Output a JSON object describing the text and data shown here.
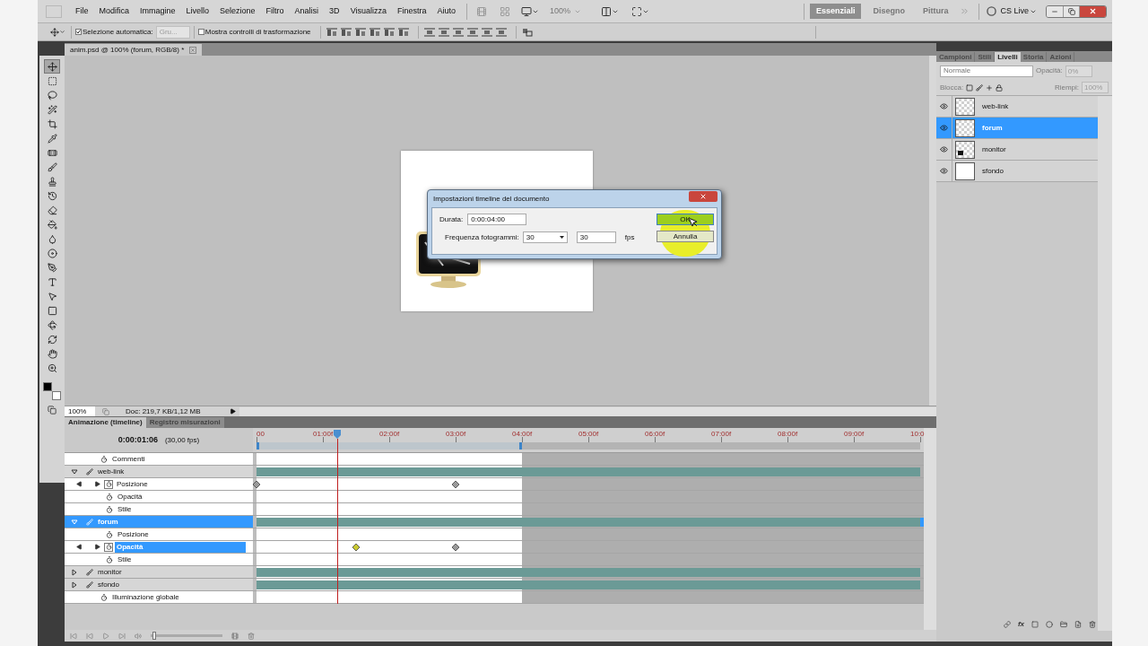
{
  "menu": [
    "File",
    "Modifica",
    "Immagine",
    "Livello",
    "Selezione",
    "Filtro",
    "Analisi",
    "3D",
    "Visualizza",
    "Finestra",
    "Aiuto"
  ],
  "zoom_menu": {
    "value": "100%",
    "disabled": true
  },
  "workspaces": [
    {
      "label": "Essenziali",
      "selected": true
    },
    {
      "label": "Disegno",
      "selected": false
    },
    {
      "label": "Pittura",
      "selected": false
    }
  ],
  "cs_live": "CS Live",
  "options": {
    "auto_select": {
      "label": "Selezione automatica:",
      "checked": true
    },
    "target": {
      "value": "Gru...",
      "disabled": true
    },
    "transform_controls": {
      "label": "Mostra controlli di trasformazione",
      "checked": false
    }
  },
  "tools": [
    {
      "kind": "move",
      "selected": true
    },
    {
      "kind": "marquee",
      "selected": false
    },
    {
      "kind": "lasso",
      "selected": false
    },
    {
      "kind": "wand",
      "selected": false
    },
    {
      "kind": "crop",
      "selected": false
    },
    {
      "kind": "eyedropper",
      "selected": false
    },
    {
      "kind": "healing",
      "selected": false
    },
    {
      "kind": "brush",
      "selected": false
    },
    {
      "kind": "stamp",
      "selected": false
    },
    {
      "kind": "history",
      "selected": false
    },
    {
      "kind": "eraser",
      "selected": false
    },
    {
      "kind": "gradient",
      "selected": false
    },
    {
      "kind": "blur",
      "selected": false
    },
    {
      "kind": "dodge",
      "selected": false
    },
    {
      "kind": "pen",
      "selected": false
    },
    {
      "kind": "type",
      "selected": false
    },
    {
      "kind": "path",
      "selected": false
    },
    {
      "kind": "shape",
      "selected": false
    },
    {
      "kind": "rotate3d",
      "selected": false
    },
    {
      "kind": "orbit",
      "selected": false
    },
    {
      "kind": "hand",
      "selected": false
    },
    {
      "kind": "zoom",
      "selected": false
    }
  ],
  "document_tab": {
    "title": "anim.psd @ 100% (forum, RGB/8) *"
  },
  "status_bar": {
    "zoom": "100%",
    "doc_info": "Doc: 219,7 KB/1,12 MB"
  },
  "layers_panel": {
    "tabs": [
      {
        "label": "Campioni",
        "selected": false
      },
      {
        "label": "Stili",
        "selected": false
      },
      {
        "label": "Livelli",
        "selected": true
      },
      {
        "label": "Storia",
        "selected": false
      },
      {
        "label": "Azioni",
        "selected": false
      }
    ],
    "blend_mode": "Normale",
    "opacity_label": "Opacità:",
    "opacity": "0%",
    "lock_label": "Blocca:",
    "fill_label": "Riempi:",
    "fill": "100%",
    "controls_disabled": true,
    "effects_button": "fx",
    "layers": [
      {
        "name": "web-link",
        "visible": true,
        "selected": false,
        "kind": "transparent"
      },
      {
        "name": "forum",
        "visible": true,
        "selected": true,
        "kind": "transparent"
      },
      {
        "name": "monitor",
        "visible": true,
        "selected": false,
        "kind": "monitor"
      },
      {
        "name": "sfondo",
        "visible": true,
        "selected": false,
        "kind": "white"
      }
    ]
  },
  "dialog": {
    "title": "Impostazioni timeline del documento",
    "duration_label": "Durata:",
    "duration": "0:00:04:00",
    "frame_rate_label": "Frequenza fotogrammi:",
    "frame_rate_preset": "30",
    "frame_rate": "30",
    "fps_label": "fps",
    "buttons": [
      {
        "label": "OK",
        "default": true
      },
      {
        "label": "Annulla",
        "default": false
      }
    ]
  },
  "timeline": {
    "tabs": [
      {
        "label": "Animazione (timeline)",
        "selected": true
      },
      {
        "label": "Registro misurazioni",
        "selected": false
      }
    ],
    "timecode": "0:00:01:06",
    "fps": "(30,00 fps)",
    "ruler": [
      "00",
      "01:00f",
      "02:00f",
      "03:00f",
      "04:00f",
      "05:00f",
      "06:00f",
      "07:00f",
      "08:00f",
      "09:00f",
      "10:0"
    ],
    "playhead": {
      "level": 0.121
    },
    "zoom_slider": {
      "level": 0.03
    },
    "work_area": {
      "level": 0.4
    },
    "rows": [
      {
        "kind": "comment",
        "label": "Commenti"
      },
      {
        "kind": "layer",
        "label": "web-link",
        "expanded": true,
        "selected": false
      },
      {
        "kind": "property",
        "label": "Posizione",
        "animated": true,
        "selected": false,
        "keyframes": [
          {
            "level": 0,
            "selected": false
          },
          {
            "level": 0.3,
            "selected": false
          }
        ]
      },
      {
        "kind": "property",
        "label": "Opacità",
        "animated": false,
        "selected": false
      },
      {
        "kind": "property",
        "label": "Stile",
        "animated": false,
        "selected": false
      },
      {
        "kind": "layer",
        "label": "forum",
        "expanded": true,
        "selected": true
      },
      {
        "kind": "property",
        "label": "Posizione",
        "animated": false,
        "selected": false
      },
      {
        "kind": "property",
        "label": "Opacità",
        "animated": true,
        "selected": true,
        "keyframes": [
          {
            "level": 0.15,
            "selected": true
          },
          {
            "level": 0.3,
            "selected": false
          }
        ]
      },
      {
        "kind": "property",
        "label": "Stile",
        "animated": false,
        "selected": false
      },
      {
        "kind": "layer",
        "label": "monitor",
        "expanded": false,
        "selected": false
      },
      {
        "kind": "layer",
        "label": "sfondo",
        "expanded": false,
        "selected": false
      },
      {
        "kind": "comment",
        "label": "Illuminazione globale"
      }
    ]
  }
}
